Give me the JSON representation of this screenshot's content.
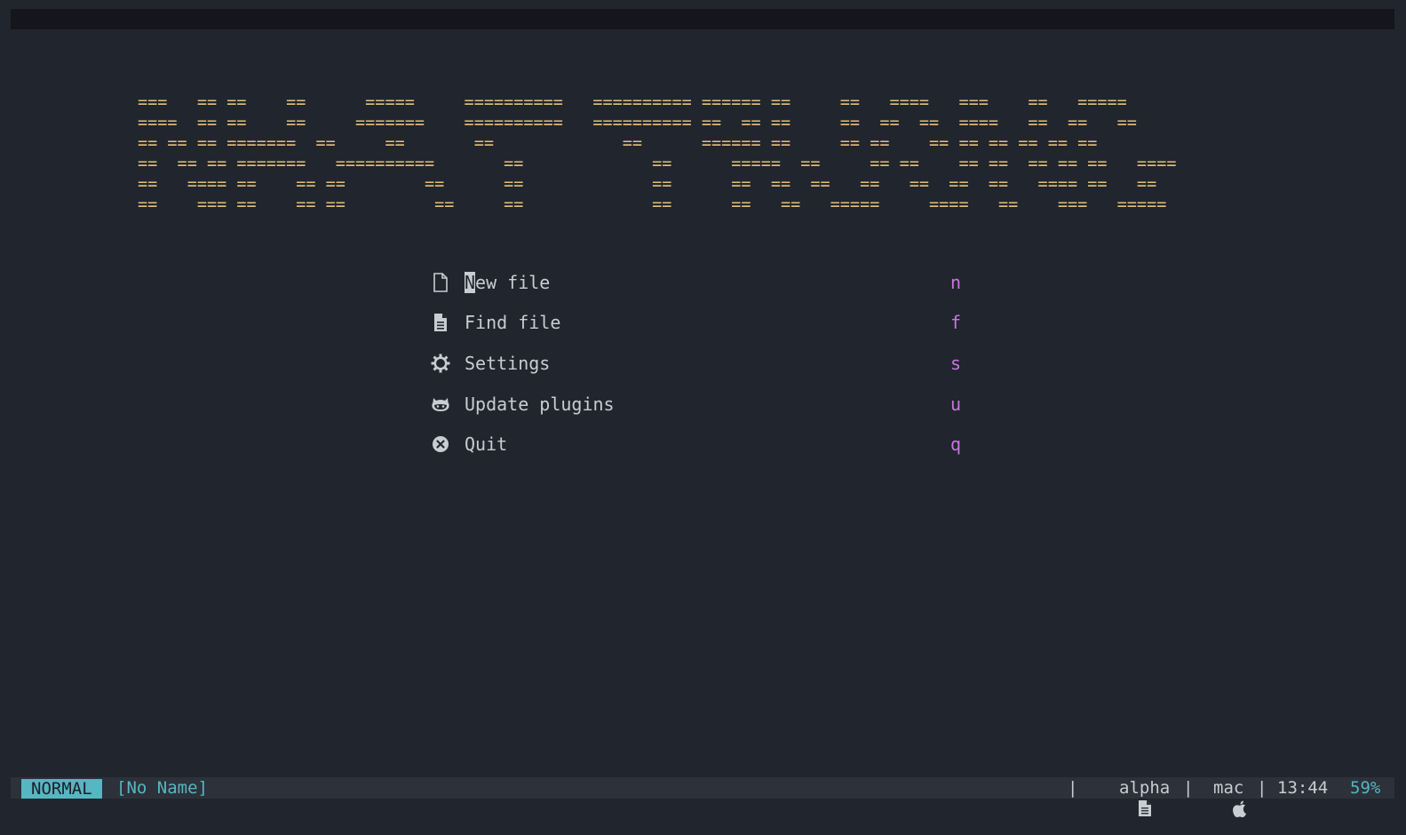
{
  "banner": {
    "lines": [
      "===   == ==    ==      =====     ==========   ========== ====== ==     ==   ====   ===    ==   =====",
      "====  == ==    ==     =======    ==========   ========== ==  == ==     ==  ==  ==  ====   ==  ==   ==",
      "== == == =======  ==     ==       ==             ==      ====== ==     == ==    == == == == == ==",
      "==  == == =======   ==========       ==             ==      =====  ==     == ==    == ==  == == ==   ====",
      "==   ==== ==    == ==        ==      ==             ==      ==  ==  ==   ==   ==  ==  ==   ==== ==   ==",
      "==    === ==    == ==         ==     ==             ==      ==   ==   =====     ====   ==    ===   ====="
    ]
  },
  "menu": {
    "items": [
      {
        "icon": "new-file-icon",
        "label": "New file",
        "key": "n"
      },
      {
        "icon": "find-file-icon",
        "label": "Find file",
        "key": "f"
      },
      {
        "icon": "settings-icon",
        "label": "Settings",
        "key": "s"
      },
      {
        "icon": "github-icon",
        "label": "Update plugins",
        "key": "u"
      },
      {
        "icon": "quit-icon",
        "label": "Quit",
        "key": "q"
      }
    ]
  },
  "statusline": {
    "mode": "NORMAL",
    "filename": "[No Name]",
    "sep1": "|",
    "filetype": "alpha",
    "sep2": "|",
    "os": "mac",
    "sep3": "|",
    "time": "13:44",
    "percent": "59%"
  },
  "colors": {
    "background": "#21252d",
    "banner": "#e5c07b",
    "key": "#c678dd",
    "accent": "#56b6c2"
  }
}
